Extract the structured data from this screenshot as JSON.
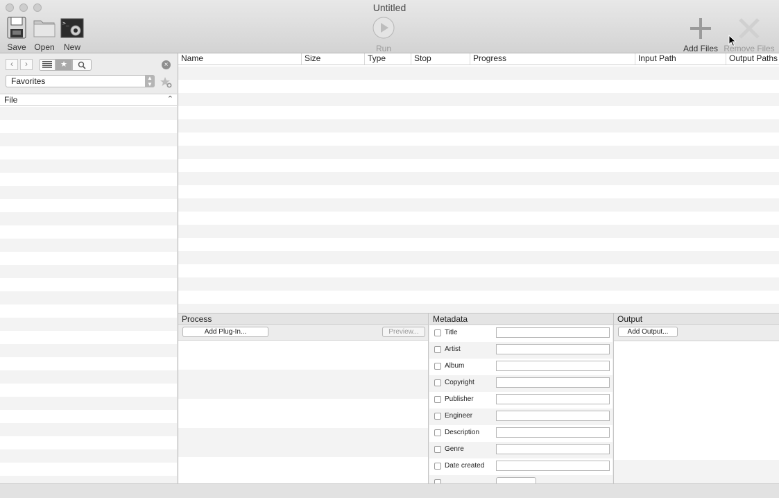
{
  "window": {
    "title": "Untitled"
  },
  "toolbar": {
    "save": "Save",
    "open": "Open",
    "new": "New",
    "run": "Run",
    "add_files": "Add Files",
    "remove_files": "Remove Files"
  },
  "sidebar": {
    "location_select": "Favorites",
    "file_column": "File"
  },
  "table": {
    "columns": [
      "Name",
      "Size",
      "Type",
      "Stop",
      "Progress",
      "Input Path",
      "Output Paths"
    ]
  },
  "process": {
    "title": "Process",
    "add_plugin": "Add Plug-In...",
    "preview": "Preview..."
  },
  "metadata": {
    "title": "Metadata",
    "fields": [
      "Title",
      "Artist",
      "Album",
      "Copyright",
      "Publisher",
      "Engineer",
      "Description",
      "Genre",
      "Date created"
    ]
  },
  "output": {
    "title": "Output",
    "add_output": "Add Output..."
  }
}
